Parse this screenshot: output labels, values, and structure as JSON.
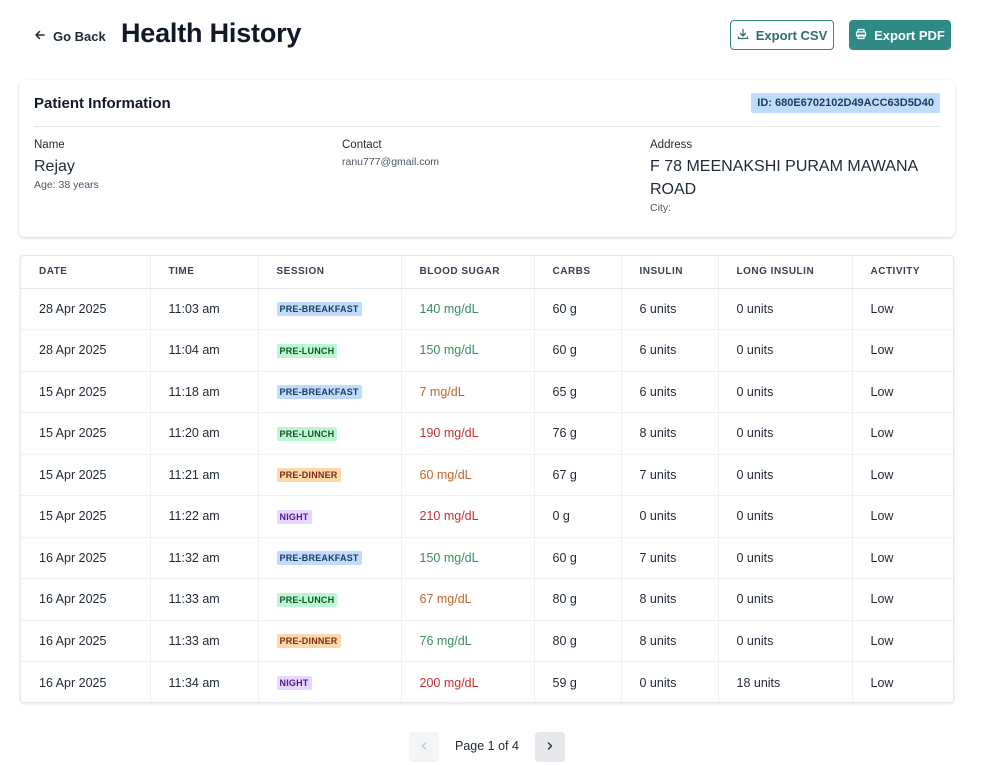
{
  "header": {
    "back_label": "Go Back",
    "title": "Health History",
    "export_csv_label": "Export CSV",
    "export_pdf_label": "Export PDF"
  },
  "patient": {
    "section_title": "Patient Information",
    "id_text": "ID: 680E6702102D49ACC63D5D40",
    "name_label": "Name",
    "name": "Rejay",
    "age_text": "Age: 38 years",
    "contact_label": "Contact",
    "contact": "ranu777@gmail.com",
    "address_label": "Address",
    "address_line1": "F 78 MEENAKSHI PURAM MAWANA",
    "address_line2": "ROAD",
    "city_text": "City:"
  },
  "table": {
    "columns": [
      "DATE",
      "TIME",
      "SESSION",
      "BLOOD SUGAR",
      "CARBS",
      "INSULIN",
      "LONG INSULIN",
      "ACTIVITY"
    ],
    "rows": [
      {
        "date": "28 Apr 2025",
        "time": "11:03 am",
        "session": "PRE-BREAKFAST",
        "session_type": "pre-breakfast",
        "sugar": "140 mg/dL",
        "sugar_level": "green",
        "carbs": "60 g",
        "insulin": "6 units",
        "long_insulin": "0 units",
        "activity": "Low"
      },
      {
        "date": "28 Apr 2025",
        "time": "11:04 am",
        "session": "PRE-LUNCH",
        "session_type": "pre-lunch",
        "sugar": "150 mg/dL",
        "sugar_level": "green",
        "carbs": "60 g",
        "insulin": "6 units",
        "long_insulin": "0 units",
        "activity": "Low"
      },
      {
        "date": "15 Apr 2025",
        "time": "11:18 am",
        "session": "PRE-BREAKFAST",
        "session_type": "pre-breakfast",
        "sugar": "7 mg/dL",
        "sugar_level": "orange",
        "carbs": "65 g",
        "insulin": "6 units",
        "long_insulin": "0 units",
        "activity": "Low"
      },
      {
        "date": "15 Apr 2025",
        "time": "11:20 am",
        "session": "PRE-LUNCH",
        "session_type": "pre-lunch",
        "sugar": "190 mg/dL",
        "sugar_level": "red",
        "carbs": "76 g",
        "insulin": "8 units",
        "long_insulin": "0 units",
        "activity": "Low"
      },
      {
        "date": "15 Apr 2025",
        "time": "11:21 am",
        "session": "PRE-DINNER",
        "session_type": "pre-dinner",
        "sugar": "60 mg/dL",
        "sugar_level": "orange",
        "carbs": "67 g",
        "insulin": "7 units",
        "long_insulin": "0 units",
        "activity": "Low"
      },
      {
        "date": "15 Apr 2025",
        "time": "11:22 am",
        "session": "NIGHT",
        "session_type": "night",
        "sugar": "210 mg/dL",
        "sugar_level": "red",
        "carbs": "0 g",
        "insulin": "0 units",
        "long_insulin": "0 units",
        "activity": "Low"
      },
      {
        "date": "16 Apr 2025",
        "time": "11:32 am",
        "session": "PRE-BREAKFAST",
        "session_type": "pre-breakfast",
        "sugar": "150 mg/dL",
        "sugar_level": "green",
        "carbs": "60 g",
        "insulin": "7 units",
        "long_insulin": "0 units",
        "activity": "Low"
      },
      {
        "date": "16 Apr 2025",
        "time": "11:33 am",
        "session": "PRE-LUNCH",
        "session_type": "pre-lunch",
        "sugar": "67 mg/dL",
        "sugar_level": "orange",
        "carbs": "80 g",
        "insulin": "8 units",
        "long_insulin": "0 units",
        "activity": "Low"
      },
      {
        "date": "16 Apr 2025",
        "time": "11:33 am",
        "session": "PRE-DINNER",
        "session_type": "pre-dinner",
        "sugar": "76 mg/dL",
        "sugar_level": "green",
        "carbs": "80 g",
        "insulin": "8 units",
        "long_insulin": "0 units",
        "activity": "Low"
      },
      {
        "date": "16 Apr 2025",
        "time": "11:34 am",
        "session": "NIGHT",
        "session_type": "night",
        "sugar": "200 mg/dL",
        "sugar_level": "red",
        "carbs": "59 g",
        "insulin": "0 units",
        "long_insulin": "18 units",
        "activity": "Low"
      }
    ]
  },
  "pagination": {
    "label": "Page 1 of 4",
    "prev_enabled": false,
    "next_enabled": true
  },
  "colors": {
    "primary": "#2f8a85",
    "sugar_green": "#3a8f5a",
    "sugar_orange": "#c2652a",
    "sugar_red": "#c43030"
  },
  "icons": {
    "back": "arrow-left-icon",
    "export_csv": "download-icon",
    "export_pdf": "printer-icon",
    "prev": "chevron-left-icon",
    "next": "chevron-right-icon"
  }
}
